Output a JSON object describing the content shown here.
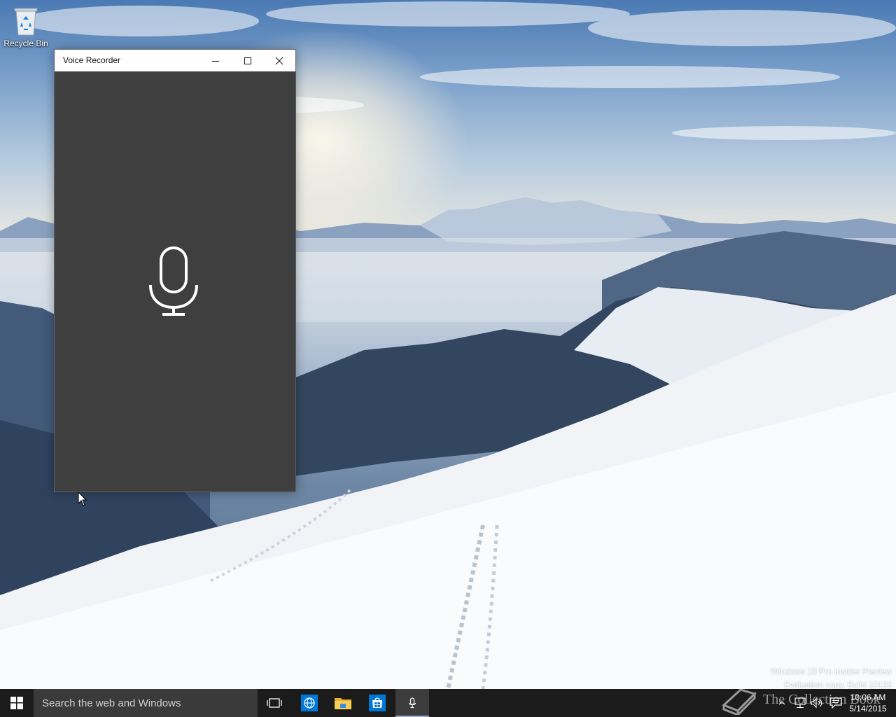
{
  "desktop": {
    "icons": [
      {
        "label": "Recycle Bin",
        "icon": "recycle-bin-icon"
      }
    ],
    "watermark": {
      "line1": "Windows 10 Pro Insider Preview",
      "line2": "Evaluation copy. Build 10122"
    },
    "overlay_brand": "The Collection Book"
  },
  "window": {
    "title": "Voice Recorder",
    "controls": {
      "minimize_icon": "minimize-icon",
      "maximize_icon": "maximize-icon",
      "close_icon": "close-icon"
    },
    "record_button_icon": "microphone-icon",
    "colors": {
      "content_bg": "#3f3f3f",
      "titlebar_bg": "#ffffff",
      "icon": "#ffffff"
    }
  },
  "taskbar": {
    "start_icon": "windows-logo-icon",
    "search_placeholder": "Search the web and Windows",
    "pinned": [
      {
        "name": "task-view",
        "icon": "task-view-icon"
      },
      {
        "name": "internet-explorer",
        "icon": "globe-icon"
      },
      {
        "name": "file-explorer",
        "icon": "folder-icon"
      },
      {
        "name": "store",
        "icon": "store-icon"
      },
      {
        "name": "voice-recorder",
        "icon": "microphone-icon",
        "active": true
      }
    ],
    "tray": {
      "icons": [
        "chevron-up-icon",
        "network-icon",
        "volume-icon",
        "action-center-icon"
      ],
      "time": "10:06 AM",
      "date": "5/14/2015"
    },
    "colors": {
      "bg": "#1b1b1b",
      "search_bg": "#3a3a3a",
      "accent": "#0078d7"
    }
  }
}
